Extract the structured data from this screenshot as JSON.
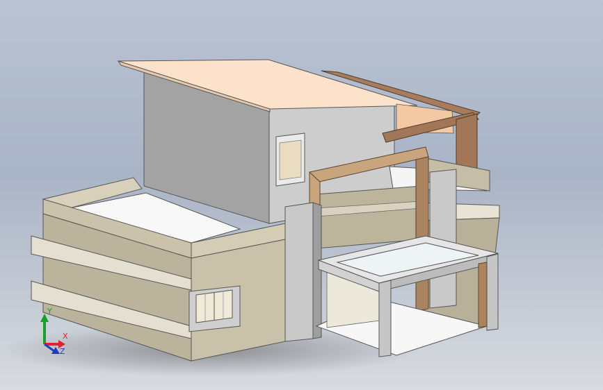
{
  "viewport": {
    "background_top": "#b9c3d3",
    "background_bottom": "#d8dbe0"
  },
  "model": {
    "colors": {
      "wall_beige": "#c9c1a8",
      "wall_beige_dark": "#b5ac92",
      "wall_grey": "#cfcfcf",
      "wall_grey_dark": "#a9a9a9",
      "roof_peach": "#fbe0c8",
      "wood_brown": "#a57a5a",
      "wood_tan": "#c8a57c",
      "floor_white": "#f7f7f7",
      "glass": "#e8eef2",
      "band_light": "#e7e2d3"
    }
  },
  "triad": {
    "labels": {
      "x": "X",
      "y": "Y",
      "z": "Z"
    },
    "colors": {
      "x": "#e0232a",
      "y": "#1c9e2d",
      "z": "#2638c7"
    }
  }
}
